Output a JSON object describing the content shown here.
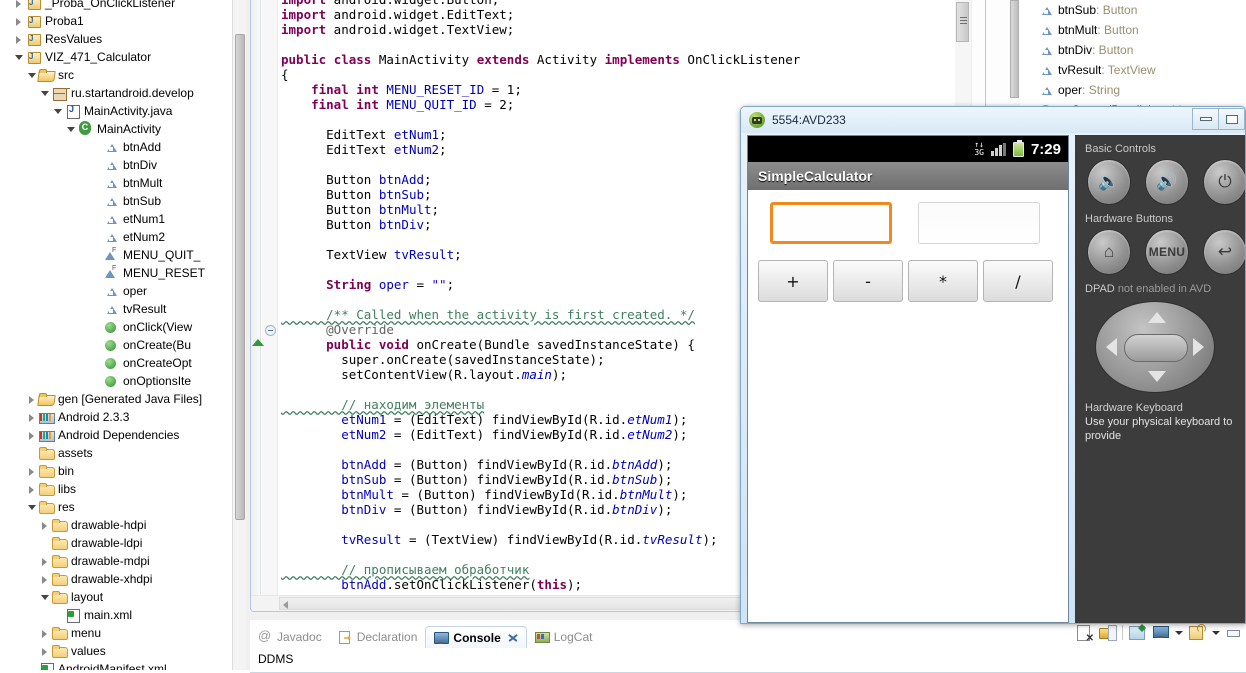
{
  "explorer": {
    "rows": [
      {
        "label": "_Proba_OnClickListener",
        "indent": 1,
        "twisty": "closed",
        "icon": "project-icon",
        "dim": false,
        "clipped": true
      },
      {
        "label": "Proba1",
        "indent": 1,
        "twisty": "closed",
        "icon": "project-icon",
        "dim": false
      },
      {
        "label": "ResValues",
        "indent": 1,
        "twisty": "closed",
        "icon": "project-icon",
        "dim": false
      },
      {
        "label": "VIZ_471_Calculator",
        "indent": 1,
        "twisty": "open",
        "icon": "project-icon",
        "dim": false
      },
      {
        "label": "src",
        "indent": 2,
        "twisty": "open",
        "icon": "source-folder-icon",
        "dim": false
      },
      {
        "label": "ru.startandroid.develop",
        "indent": 3,
        "twisty": "open",
        "icon": "package-icon",
        "dim": false
      },
      {
        "label": "MainActivity.java",
        "indent": 4,
        "twisty": "open",
        "icon": "java-file-icon",
        "dim": false
      },
      {
        "label": "MainActivity",
        "indent": 5,
        "twisty": "open",
        "icon": "class-icon",
        "dim": false
      },
      {
        "label": "btnAdd",
        "indent": 7,
        "twisty": "none",
        "icon": "field-icon",
        "dim": false
      },
      {
        "label": "btnDiv",
        "indent": 7,
        "twisty": "none",
        "icon": "field-icon",
        "dim": false
      },
      {
        "label": "btnMult",
        "indent": 7,
        "twisty": "none",
        "icon": "field-icon",
        "dim": false
      },
      {
        "label": "btnSub",
        "indent": 7,
        "twisty": "none",
        "icon": "field-icon",
        "dim": false
      },
      {
        "label": "etNum1",
        "indent": 7,
        "twisty": "none",
        "icon": "field-icon",
        "dim": false
      },
      {
        "label": "etNum2",
        "indent": 7,
        "twisty": "none",
        "icon": "field-icon",
        "dim": false
      },
      {
        "label": "MENU_QUIT_",
        "indent": 7,
        "twisty": "none",
        "icon": "final-field-icon",
        "dim": false
      },
      {
        "label": "MENU_RESET",
        "indent": 7,
        "twisty": "none",
        "icon": "final-field-icon",
        "dim": false
      },
      {
        "label": "oper",
        "indent": 7,
        "twisty": "none",
        "icon": "field-icon",
        "dim": false
      },
      {
        "label": "tvResult",
        "indent": 7,
        "twisty": "none",
        "icon": "field-icon",
        "dim": false
      },
      {
        "label": "onClick(View",
        "indent": 7,
        "twisty": "none",
        "icon": "method-icon",
        "dim": false
      },
      {
        "label": "onCreate(Bu",
        "indent": 7,
        "twisty": "none",
        "icon": "method-icon",
        "dim": false
      },
      {
        "label": "onCreateOpt",
        "indent": 7,
        "twisty": "none",
        "icon": "method-icon",
        "dim": false
      },
      {
        "label": "onOptionsIte",
        "indent": 7,
        "twisty": "none",
        "icon": "method-icon",
        "dim": false
      },
      {
        "label": "gen [Generated Java Files]",
        "indent": 2,
        "twisty": "closed",
        "icon": "source-folder-icon",
        "dim": true,
        "prefix": "gen "
      },
      {
        "label": "Android 2.3.3",
        "indent": 2,
        "twisty": "closed",
        "icon": "library-icon",
        "dim": false
      },
      {
        "label": "Android Dependencies",
        "indent": 2,
        "twisty": "closed",
        "icon": "library-icon",
        "dim": false
      },
      {
        "label": "assets",
        "indent": 2,
        "twisty": "none",
        "icon": "folder-icon",
        "dim": false
      },
      {
        "label": "bin",
        "indent": 2,
        "twisty": "closed",
        "icon": "folder-icon",
        "dim": false
      },
      {
        "label": "libs",
        "indent": 2,
        "twisty": "closed",
        "icon": "folder-icon",
        "dim": false
      },
      {
        "label": "res",
        "indent": 2,
        "twisty": "open",
        "icon": "folder-icon",
        "dim": false
      },
      {
        "label": "drawable-hdpi",
        "indent": 3,
        "twisty": "closed",
        "icon": "folder-icon",
        "dim": false
      },
      {
        "label": "drawable-ldpi",
        "indent": 3,
        "twisty": "none",
        "icon": "folder-icon",
        "dim": false
      },
      {
        "label": "drawable-mdpi",
        "indent": 3,
        "twisty": "closed",
        "icon": "folder-icon",
        "dim": false
      },
      {
        "label": "drawable-xhdpi",
        "indent": 3,
        "twisty": "closed",
        "icon": "folder-icon",
        "dim": false
      },
      {
        "label": "layout",
        "indent": 3,
        "twisty": "open",
        "icon": "folder-icon",
        "dim": false
      },
      {
        "label": "main.xml",
        "indent": 4,
        "twisty": "none",
        "icon": "xml-file-icon",
        "dim": false
      },
      {
        "label": "menu",
        "indent": 3,
        "twisty": "closed",
        "icon": "folder-icon",
        "dim": false
      },
      {
        "label": "values",
        "indent": 3,
        "twisty": "closed",
        "icon": "folder-icon",
        "dim": false
      },
      {
        "label": "AndroidManifest.xml",
        "indent": 2,
        "twisty": "none",
        "icon": "xml-file-icon",
        "dim": false
      }
    ]
  },
  "editor": {
    "code_lines": [
      "import android.widget.Button;",
      "import android.widget.EditText;",
      "import android.widget.TextView;",
      "",
      "public class MainActivity extends Activity implements OnClickListener",
      "{",
      "    final int MENU_RESET_ID = 1;",
      "    final int MENU_QUIT_ID = 2;",
      "",
      "      EditText etNum1;",
      "      EditText etNum2;",
      "",
      "      Button btnAdd;",
      "      Button btnSub;",
      "      Button btnMult;",
      "      Button btnDiv;",
      "",
      "      TextView tvResult;",
      "",
      "      String oper = \"\";",
      "",
      "      /** Called when the activity is first created. */",
      "      @Override",
      "      public void onCreate(Bundle savedInstanceState) {",
      "        super.onCreate(savedInstanceState);",
      "        setContentView(R.layout.main);",
      "",
      "        // находим элементы",
      "        etNum1 = (EditText) findViewById(R.id.etNum1);",
      "        etNum2 = (EditText) findViewById(R.id.etNum2);",
      "",
      "        btnAdd = (Button) findViewById(R.id.btnAdd);",
      "        btnSub = (Button) findViewById(R.id.btnSub);",
      "        btnMult = (Button) findViewById(R.id.btnMult);",
      "        btnDiv = (Button) findViewById(R.id.btnDiv);",
      "",
      "        tvResult = (TextView) findViewById(R.id.tvResult);",
      "",
      "        // прописываем обработчик",
      "        btnAdd.setOnClickListener(this);"
    ]
  },
  "outline": {
    "rows": [
      {
        "name": "btnSub",
        "type": " : Button"
      },
      {
        "name": "btnMult",
        "type": " : Button"
      },
      {
        "name": "btnDiv",
        "type": " : Button"
      },
      {
        "name": "tvResult",
        "type": " : TextView"
      },
      {
        "name": "oper",
        "type": " : String"
      },
      {
        "name": "onCreate(Bundle)",
        "type": " : void"
      }
    ]
  },
  "bottom_panel": {
    "tabs": [
      {
        "label": "Javadoc",
        "icon": "javadoc-icon",
        "active": false
      },
      {
        "label": "Declaration",
        "icon": "declaration-icon",
        "active": false
      },
      {
        "label": "Console",
        "icon": "console-icon",
        "active": true
      },
      {
        "label": "LogCat",
        "icon": "logcat-icon",
        "active": false
      }
    ],
    "content_label": "DDMS",
    "tools": [
      "clear-console-icon",
      "lock-scroll-icon",
      "pin-console-icon",
      "display-selected-console-icon",
      "open-console-icon",
      "minimize-icon"
    ]
  },
  "emulator": {
    "title": "5554:AVD233",
    "window_buttons": [
      "minimize-button",
      "restore-button"
    ],
    "status_bar": {
      "network": "3G",
      "time": "7:29",
      "signal_icon": "signal-bars-icon",
      "battery_icon": "battery-icon"
    },
    "app_title": "SimpleCalculator",
    "fields": [
      {
        "name": "etNum1",
        "value": "",
        "focused": true
      },
      {
        "name": "etNum2",
        "value": "",
        "focused": false
      }
    ],
    "buttons": [
      {
        "id": "btnAdd",
        "label": "+"
      },
      {
        "id": "btnSub",
        "label": "-"
      },
      {
        "id": "btnMult",
        "label": "*"
      },
      {
        "id": "btnDiv",
        "label": "/"
      }
    ],
    "focus_color": "#f08a1e"
  },
  "avd_panel": {
    "sections": [
      {
        "title": "Basic Controls",
        "buttons": [
          {
            "name": "volume-down-button",
            "glyph": "🔈"
          },
          {
            "name": "volume-up-button",
            "glyph": "🔊"
          },
          {
            "name": "power-button",
            "glyph": "⏻"
          }
        ]
      },
      {
        "title": "Hardware Buttons",
        "buttons": [
          {
            "name": "home-button",
            "glyph": "⌂"
          },
          {
            "name": "menu-button",
            "glyph": "MENU"
          },
          {
            "name": "back-button",
            "glyph": "↩"
          }
        ]
      }
    ],
    "dpad_title": "DPAD",
    "dpad_status": "not enabled in AVD",
    "keyboard_title": "Hardware Keyboard",
    "keyboard_text": "Use your physical keyboard to provide"
  }
}
